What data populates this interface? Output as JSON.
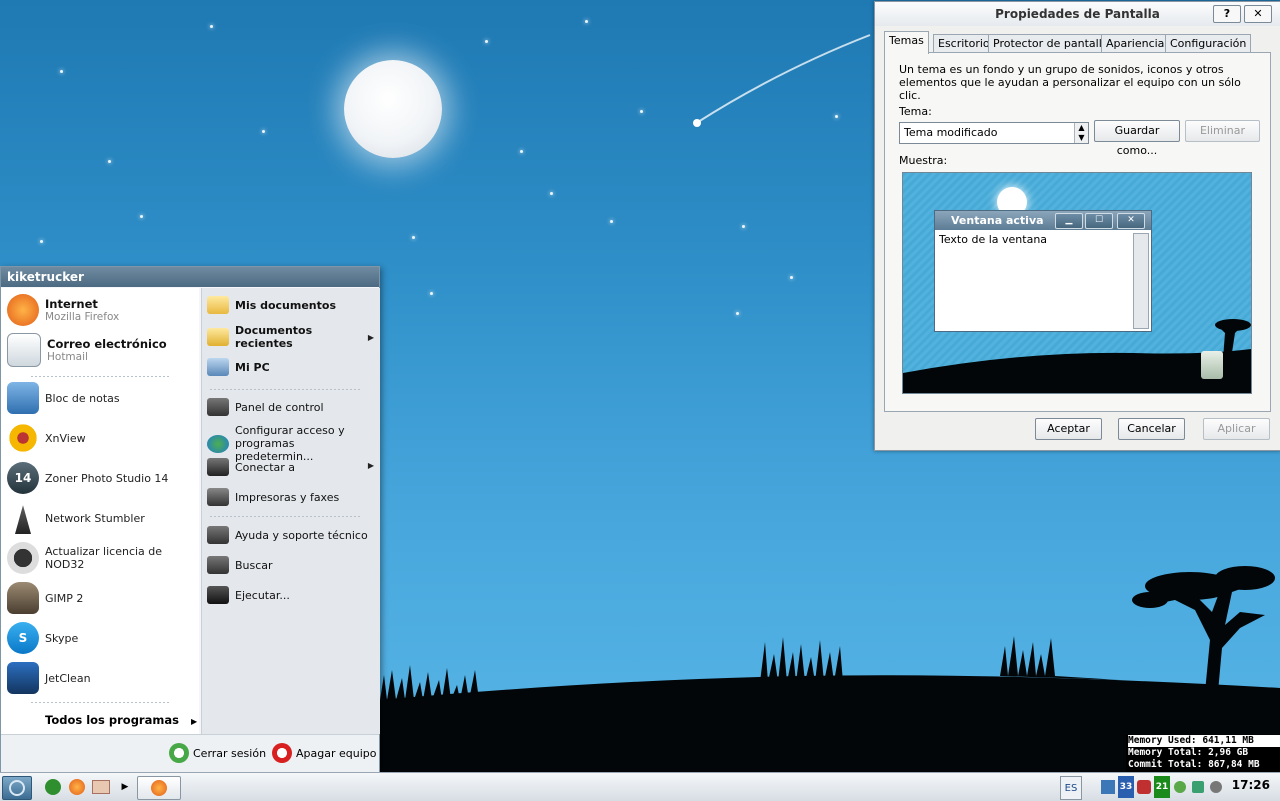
{
  "start_menu": {
    "user": "kiketrucker",
    "pinned": [
      {
        "title": "Internet",
        "subtitle": "Mozilla Firefox",
        "icon": "firefox-icon"
      },
      {
        "title": "Correo electrónico",
        "subtitle": "Hotmail",
        "icon": "mail-icon"
      }
    ],
    "recent": [
      {
        "label": "Bloc de notas",
        "icon": "notepad-icon"
      },
      {
        "label": "XnView",
        "icon": "xnview-icon"
      },
      {
        "label": "Zoner Photo Studio 14",
        "icon": "zoner-icon"
      },
      {
        "label": "Network Stumbler",
        "icon": "antenna-icon"
      },
      {
        "label": "Actualizar licencia de NOD32",
        "icon": "nod32-icon"
      },
      {
        "label": "GIMP 2",
        "icon": "gimp-icon"
      },
      {
        "label": "Skype",
        "icon": "skype-icon"
      },
      {
        "label": "JetClean",
        "icon": "jetclean-icon"
      }
    ],
    "all_programs": "Todos los programas",
    "places": [
      {
        "label": "Mis documentos",
        "icon": "documents-icon"
      },
      {
        "label": "Documentos recientes",
        "icon": "folder-icon"
      },
      {
        "label": "Mi PC",
        "icon": "computer-icon"
      }
    ],
    "system": [
      {
        "label": "Panel de control",
        "icon": "control-panel-icon"
      },
      {
        "label": "Configurar acceso y programas predetermin...",
        "icon": "defaults-icon"
      },
      {
        "label": "Conectar a",
        "icon": "network-icon"
      },
      {
        "label": "Impresoras y faxes",
        "icon": "printer-icon"
      },
      {
        "label": "Ayuda y soporte técnico",
        "icon": "help-icon"
      },
      {
        "label": "Buscar",
        "icon": "search-icon"
      },
      {
        "label": "Ejecutar...",
        "icon": "run-icon"
      }
    ],
    "logoff": "Cerrar sesión",
    "shutdown": "Apagar equipo"
  },
  "dialog": {
    "title": "Propiedades de Pantalla",
    "help_btn": "?",
    "close_btn": "✕",
    "tabs": [
      "Temas",
      "Escritorio",
      "Protector de pantalla",
      "Apariencia",
      "Configuración"
    ],
    "description": "Un tema es un fondo y un grupo de sonidos, iconos y otros elementos que le ayudan a personalizar el equipo con un sólo clic.",
    "theme_label": "Tema:",
    "theme_value": "Tema modificado",
    "save_as": "Guardar como...",
    "delete": "Eliminar",
    "sample_label": "Muestra:",
    "preview_window_title": "Ventana activa",
    "preview_window_text": "Texto de la ventana",
    "ok": "Aceptar",
    "cancel": "Cancelar",
    "apply": "Aplicar"
  },
  "memory": {
    "used": "Memory Used: 641,11 MB",
    "total": "Memory Total: 2,96 GB",
    "commit": "Commit Total: 867,84 MB"
  },
  "taskbar": {
    "language": "ES",
    "tray_badge_1": "33",
    "tray_badge_2": "21",
    "clock": "17:26"
  }
}
